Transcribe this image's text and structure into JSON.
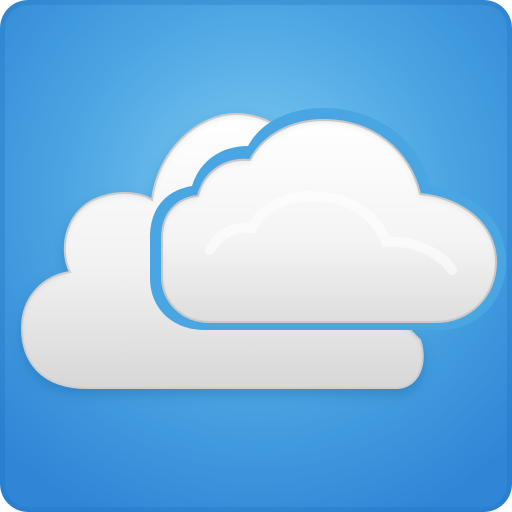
{
  "app_icon": {
    "name": "cloud-icon",
    "colors": {
      "background_light": "#7fcbf1",
      "background_mid": "#4aa4e2",
      "background_dark": "#2f86d6",
      "cloud_light": "#ffffff",
      "cloud_mid": "#eeeeee",
      "cloud_dark": "#d4d4d4",
      "cloud_outline": "#c9c9c9"
    }
  }
}
